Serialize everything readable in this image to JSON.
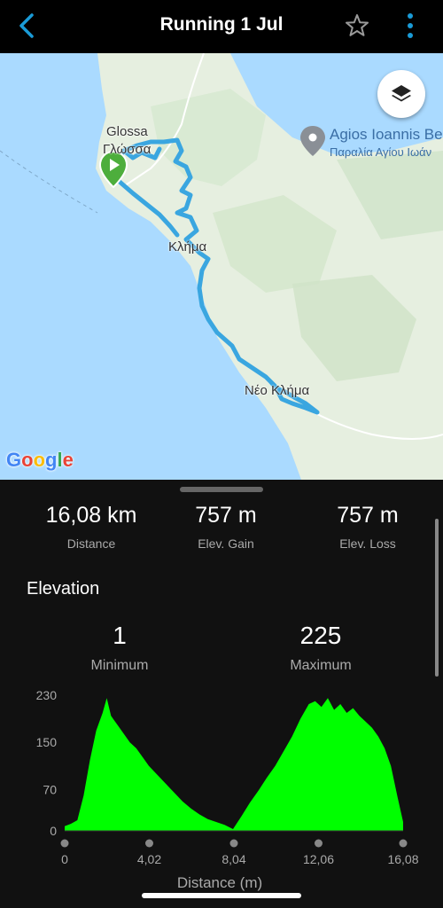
{
  "header": {
    "title": "Running 1 Jul",
    "back_icon": "chevron-left-icon",
    "star_icon": "star-outline-icon",
    "more_icon": "more-vertical-icon",
    "accent": "#1a9bd7"
  },
  "map": {
    "labels": {
      "glossa_latin": "Glossa",
      "glossa_greek": "Γλώσσα",
      "klima": "Κλήμα",
      "neo_klima": "Νέο Κλήμα",
      "poi_title": "Agios Ioannis Be",
      "poi_subtitle": "Παραλία Αγίου Ιωάν"
    },
    "provider": "Google",
    "layers_icon": "layers-icon",
    "start_marker_icon": "play-marker-icon",
    "route_color": "#3aa6e0",
    "sea_color": "#aadaff",
    "land_color": "#e8f0e0"
  },
  "stats": [
    {
      "value": "16,08 km",
      "label": "Distance"
    },
    {
      "value": "757 m",
      "label": "Elev. Gain"
    },
    {
      "value": "757 m",
      "label": "Elev. Loss"
    }
  ],
  "elevation": {
    "title": "Elevation",
    "minimum": {
      "value": "1",
      "label": "Minimum"
    },
    "maximum": {
      "value": "225",
      "label": "Maximum"
    }
  },
  "chart_data": {
    "type": "area",
    "xlabel": "Distance (m)",
    "ylabel": "",
    "xlim": [
      0,
      16.08
    ],
    "ylim": [
      0,
      230
    ],
    "x_ticks": [
      "0",
      "4,02",
      "8,04",
      "12,06",
      "16,08"
    ],
    "y_ticks": [
      "0",
      "70",
      "150",
      "230"
    ],
    "color": "#00ff00",
    "grid": false,
    "x": [
      0,
      0.3,
      0.6,
      0.9,
      1.2,
      1.5,
      1.8,
      2.0,
      2.2,
      2.5,
      2.8,
      3.1,
      3.4,
      3.7,
      4.0,
      4.4,
      4.8,
      5.2,
      5.6,
      6.0,
      6.4,
      6.8,
      7.2,
      7.6,
      8.0,
      8.4,
      8.8,
      9.2,
      9.6,
      10.0,
      10.4,
      10.8,
      11.2,
      11.6,
      11.9,
      12.2,
      12.5,
      12.8,
      13.1,
      13.4,
      13.7,
      14.0,
      14.3,
      14.6,
      14.9,
      15.2,
      15.5,
      15.8,
      16.08
    ],
    "y": [
      8,
      12,
      18,
      60,
      120,
      170,
      200,
      225,
      195,
      180,
      165,
      150,
      140,
      125,
      110,
      95,
      80,
      65,
      50,
      38,
      28,
      20,
      15,
      10,
      3,
      25,
      48,
      68,
      90,
      110,
      135,
      160,
      190,
      215,
      220,
      210,
      225,
      205,
      215,
      200,
      208,
      195,
      185,
      175,
      160,
      140,
      110,
      60,
      15
    ]
  }
}
